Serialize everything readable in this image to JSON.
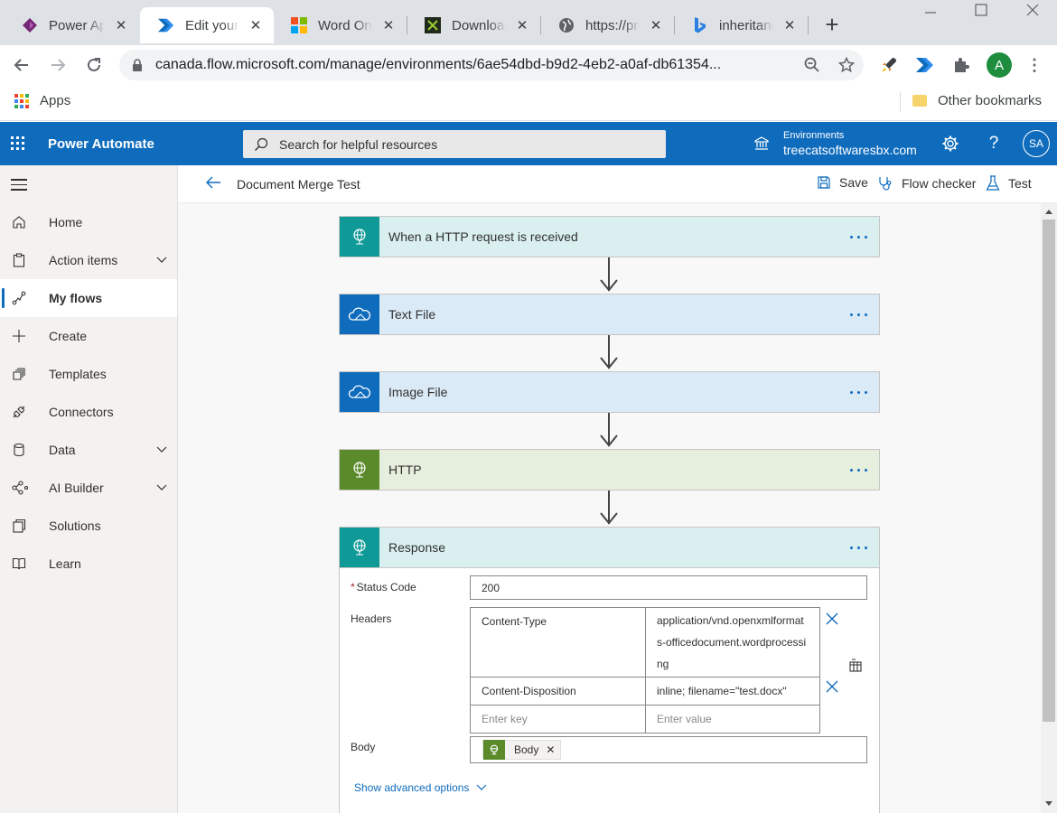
{
  "browser": {
    "tabs": [
      {
        "label": "Power Apps",
        "icon": "power-apps-icon"
      },
      {
        "label": "Edit your flow | Power Automate",
        "icon": "power-automate-icon"
      },
      {
        "label": "Word Online",
        "icon": "microsoft-icon"
      },
      {
        "label": "Download",
        "icon": "download-site-icon"
      },
      {
        "label": "https://products.office.com",
        "icon": "globe-icon"
      },
      {
        "label": "inheritance",
        "icon": "bing-icon"
      }
    ],
    "url": "canada.flow.microsoft.com/manage/environments/6ae54dbd-b9d2-4eb2-a0af-db61354...",
    "profile_initial": "A",
    "bookmarks": {
      "apps": "Apps",
      "other": "Other bookmarks"
    }
  },
  "app": {
    "title": "Power Automate",
    "search_placeholder": "Search for helpful resources",
    "environment_label": "Environments",
    "environment_name": "treecatsoftwaresbx.com",
    "user_initials": "SA",
    "brand_color": "#0f6cbd"
  },
  "nav": {
    "items": [
      {
        "label": "Home",
        "icon": "home-icon"
      },
      {
        "label": "Action items",
        "icon": "clipboard-icon",
        "expandable": true
      },
      {
        "label": "My flows",
        "icon": "flow-icon",
        "selected": true
      },
      {
        "label": "Create",
        "icon": "plus-icon"
      },
      {
        "label": "Templates",
        "icon": "templates-icon"
      },
      {
        "label": "Connectors",
        "icon": "connector-icon"
      },
      {
        "label": "Data",
        "icon": "database-icon",
        "expandable": true
      },
      {
        "label": "AI Builder",
        "icon": "ai-builder-icon",
        "expandable": true
      },
      {
        "label": "Solutions",
        "icon": "solutions-icon"
      },
      {
        "label": "Learn",
        "icon": "book-icon"
      }
    ]
  },
  "command_bar": {
    "flow_name": "Document Merge Test",
    "save": "Save",
    "flow_checker": "Flow checker",
    "test": "Test"
  },
  "flow": {
    "steps": [
      {
        "title": "When a HTTP request is received",
        "icon_color": "#0f9a98",
        "bg": "#d9eff0"
      },
      {
        "title": "Text File",
        "icon_color": "#0f6cbd",
        "bg": "#dbeaf7"
      },
      {
        "title": "Image File",
        "icon_color": "#0f6cbd",
        "bg": "#dbeaf7"
      },
      {
        "title": "HTTP",
        "icon_color": "#5a8a2a",
        "bg": "#e6eedd"
      },
      {
        "title": "Response",
        "icon_color": "#0f9a98",
        "bg": "#d9eff0"
      }
    ],
    "response": {
      "status_code_label": "Status Code",
      "status_code_value": "200",
      "headers_label": "Headers",
      "headers": [
        {
          "key": "Content-Type",
          "value": "application/vnd.openxmlformats-officedocument.wordprocessing",
          "value_lines": [
            "application/vnd.openxmlformat",
            "s-officedocument.wordprocessi",
            "ng"
          ]
        },
        {
          "key": "Content-Disposition",
          "value": "inline; filename=\"test.docx\""
        }
      ],
      "key_placeholder": "Enter key",
      "value_placeholder": "Enter value",
      "body_label": "Body",
      "body_token": "Body",
      "advanced": "Show advanced options"
    }
  }
}
